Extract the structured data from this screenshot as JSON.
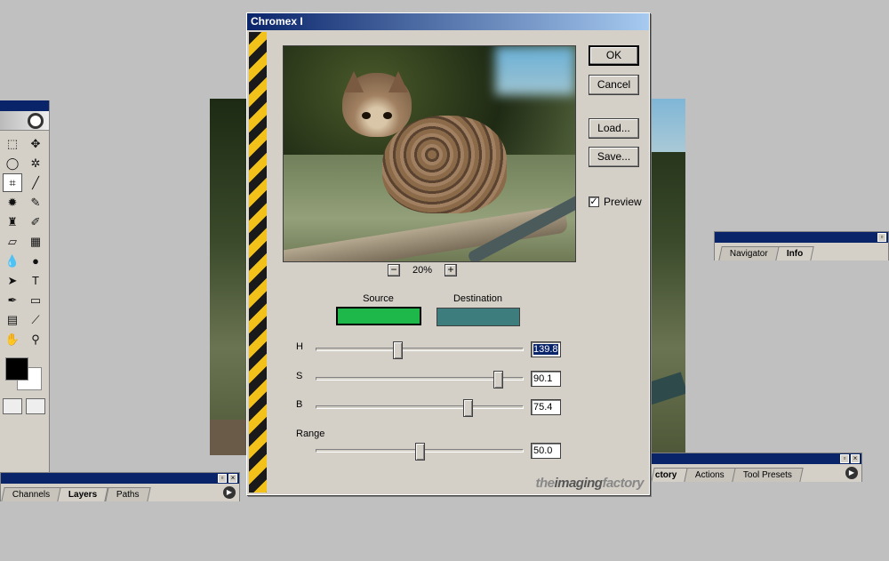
{
  "dialog": {
    "title": "Chromex I",
    "ok_label": "OK",
    "cancel_label": "Cancel",
    "load_label": "Load...",
    "save_label": "Save...",
    "preview_label": "Preview",
    "preview_checked": true,
    "zoom_level": "20%",
    "zoom_out": "−",
    "zoom_in": "+",
    "source_label": "Source",
    "destination_label": "Destination",
    "source_color": "#1db74a",
    "destination_color": "#3d7d7d",
    "sliders": [
      {
        "label": "H",
        "value": "139.8",
        "fraction": 0.39
      },
      {
        "label": "S",
        "value": "90.1",
        "fraction": 0.9
      },
      {
        "label": "B",
        "value": "75.4",
        "fraction": 0.745
      },
      {
        "label": "Range",
        "value": "50.0",
        "fraction": 0.5
      }
    ],
    "brand": {
      "part1": "the",
      "part2": "imaging",
      "part3": "factory"
    }
  },
  "layers_palette": {
    "tabs": [
      "Channels",
      "Layers",
      "Paths"
    ],
    "active": "Layers"
  },
  "nav_palette": {
    "tabs": [
      "Navigator",
      "Info"
    ],
    "active": "Info"
  },
  "history_palette": {
    "tabs": [
      "ctory",
      "Actions",
      "Tool Presets"
    ],
    "active": "ctory"
  },
  "colors": {
    "titlebar": "#0a246a",
    "hazard_yellow": "#f2c21b"
  }
}
